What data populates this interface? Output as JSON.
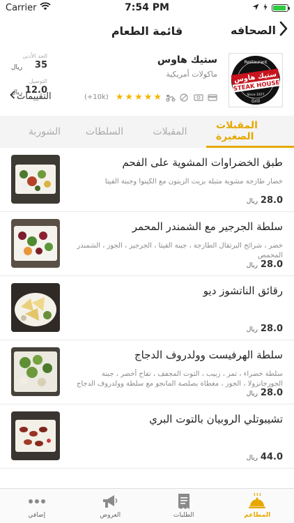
{
  "status_bar": {
    "carrier": "Carrier",
    "time": "7:54 PM",
    "battery_level": 0.9
  },
  "nav": {
    "title": "قائمة الطعام",
    "back_label": "الصحافه"
  },
  "restaurant": {
    "name": "ستيك هاوس",
    "cuisine": "ماكولات أمريكية",
    "logo_text_ar": "ستيك هاوس",
    "logo_text_en": "STEAK HOUSE",
    "logo_ring_top": "Restaurant",
    "logo_ring_bottom": "Grill",
    "logo_since": "Since 1977",
    "rating_stars": 5,
    "rating_count": "(+10k)",
    "min_order_label": "الحد الأدنى",
    "min_order_value": "35",
    "min_order_unit": "ريال",
    "delivery_label": "التوصيل",
    "delivery_value": "12.0",
    "delivery_unit": "ريال",
    "reviews_label": "التقييمات",
    "meta_icons": [
      "card-icon",
      "cash-icon",
      "no-smoking-icon",
      "delivery-scooter-icon"
    ]
  },
  "tabs": [
    {
      "label": "المقبلات الصغيرة",
      "active": true
    },
    {
      "label": "المقبلات",
      "active": false
    },
    {
      "label": "السلطات",
      "active": false
    },
    {
      "label": "الشوربة",
      "active": false
    }
  ],
  "menu_items": [
    {
      "name": "طبق الخضراوات المشوية على الفحم",
      "description": "خضار طازجة مشوية متبلة بزيت الزيتون مع الكينوا وجبنة الفيتا",
      "price": "28.0",
      "currency": "ريال"
    },
    {
      "name": "سلطة الجرجير مع الشمندر المحمر",
      "description": "خضر ، شرائح البرتقال الطازجة ، جبنة الفيتا ، الجرجير ، الجوز ، الشمندر المحمص",
      "price": "28.0",
      "currency": "ريال"
    },
    {
      "name": "رقائق الناتشوز ديو",
      "description": "",
      "price": "28.0",
      "currency": "ريال"
    },
    {
      "name": "سلطة الهرفيست وولدروف الدجاج",
      "description": "سلطة خضراء ، تمر ، زبيب ، التوت المجفف ، تفاح أخضر ، جبنة الجورجانزولا ، الجوز ، مغطاة بصلصة المانجو مع سلطة وولدروف الدجاج",
      "price": "28.0",
      "currency": "ريال"
    },
    {
      "name": "تشيبوتلي الروبيان بالتوت البري",
      "description": "",
      "price": "44.0",
      "currency": "ريال"
    }
  ],
  "tab_bar": [
    {
      "label": "إضافي",
      "icon": "more-icon",
      "active": false
    },
    {
      "label": "العروض",
      "icon": "megaphone-icon",
      "active": false
    },
    {
      "label": "الطلبات",
      "icon": "receipt-icon",
      "active": false
    },
    {
      "label": "المطاعم",
      "icon": "cloche-icon",
      "active": true
    }
  ],
  "colors": {
    "accent": "#e6a800",
    "star": "#f2b705",
    "tabs_bg": "#f4f4f4"
  }
}
